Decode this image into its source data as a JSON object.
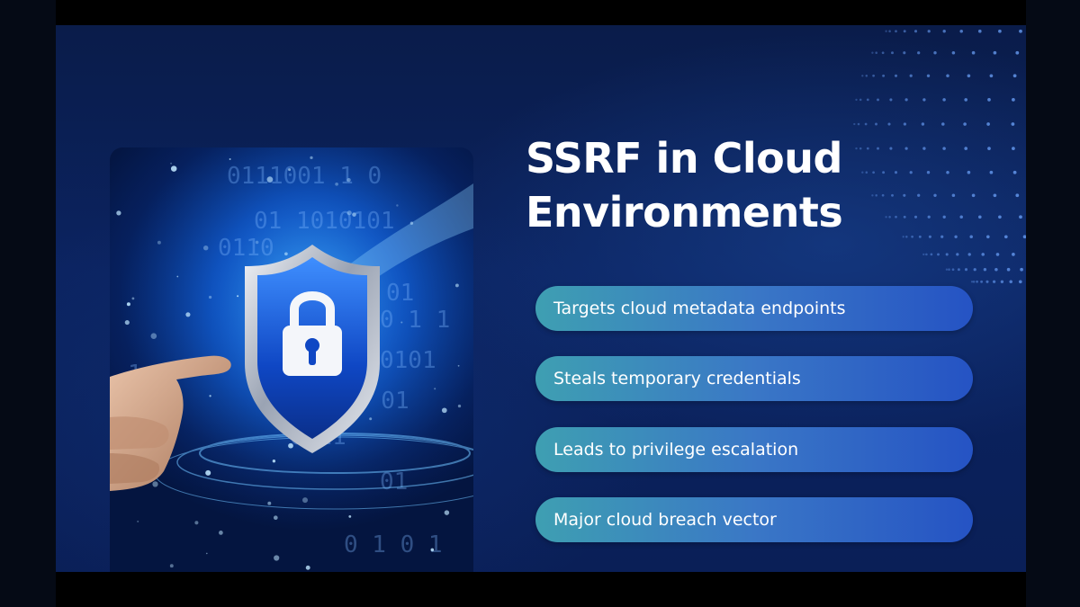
{
  "slide": {
    "title_line1": "SSRF in Cloud",
    "title_line2": "Environments",
    "bullets": [
      {
        "label": "Targets cloud metadata endpoints"
      },
      {
        "label": "Steals temporary credentials"
      },
      {
        "label": "Leads to privilege escalation"
      },
      {
        "label": "Major cloud breach vector"
      }
    ],
    "hero_image": {
      "icons": [
        "shield-icon",
        "padlock-icon",
        "pointing-hand"
      ]
    },
    "decor": {
      "icons": [
        "dotted-globe-icon"
      ]
    },
    "colors": {
      "background": "#0b2360",
      "bullet_start": "#3e9fb2",
      "bullet_end": "#2553c4",
      "title": "#ffffff"
    }
  }
}
